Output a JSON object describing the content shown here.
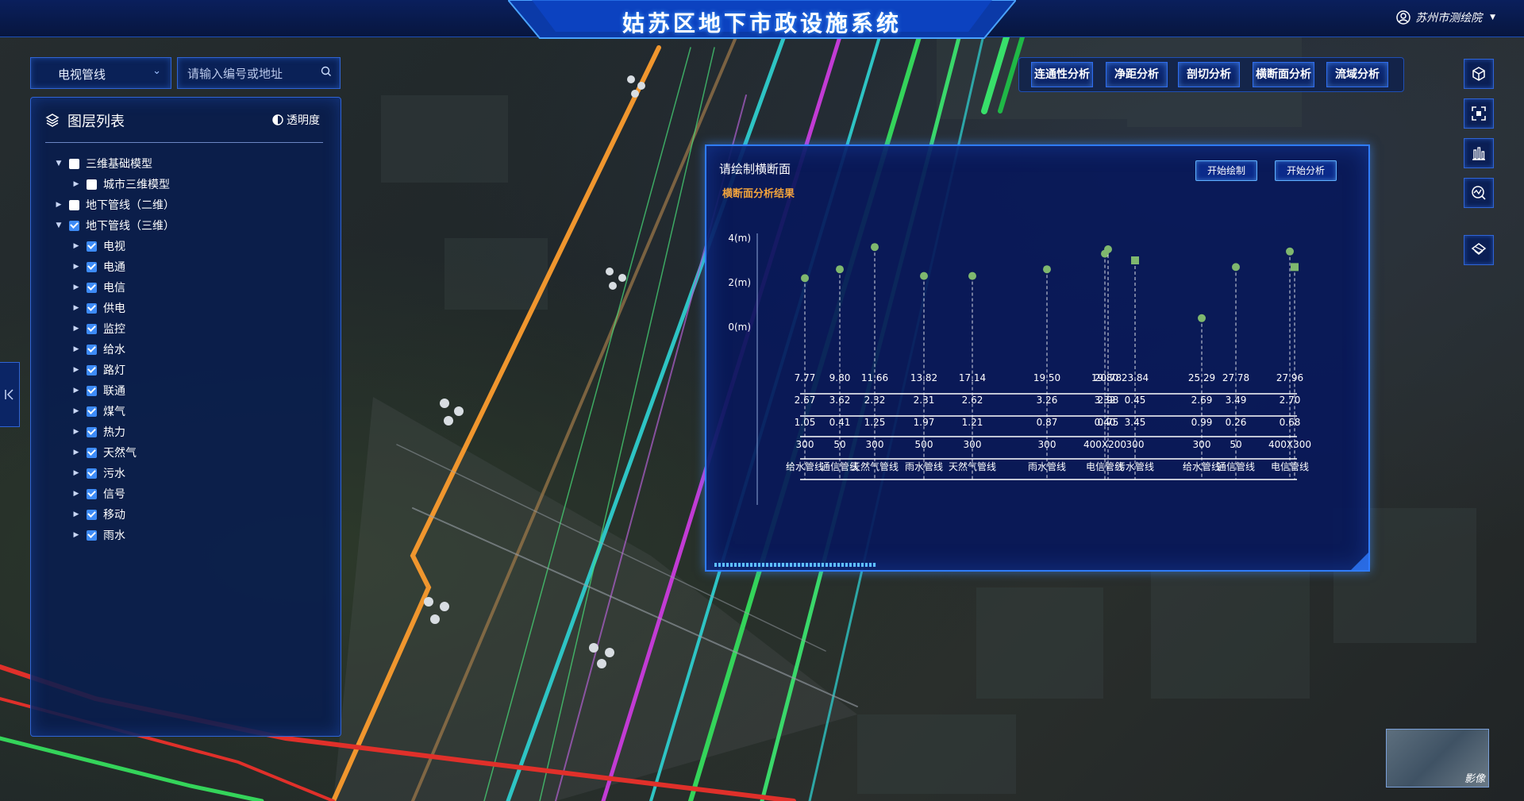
{
  "app": {
    "title": "姑苏区地下市政设施系统",
    "user": "苏州市测绘院"
  },
  "search": {
    "layer_select": "电视管线",
    "placeholder": "请输入编号或地址"
  },
  "toolbar": {
    "buttons": [
      "连通性分析",
      "净距分析",
      "剖切分析",
      "横断面分析",
      "流域分析"
    ]
  },
  "right_tools": [
    "cube-icon",
    "frame-icon",
    "bar-chart-icon",
    "chart-search-icon",
    "layers-icon"
  ],
  "layer_panel": {
    "title": "图层列表",
    "opacity_label": "透明度",
    "tree": [
      {
        "label": "三维基础模型",
        "level": 0,
        "expanded": true,
        "checked": false
      },
      {
        "label": "城市三维模型",
        "level": 1,
        "expanded": false,
        "checked": false
      },
      {
        "label": "地下管线（二维）",
        "level": 0,
        "expanded": false,
        "checked": false
      },
      {
        "label": "地下管线（三维）",
        "level": 0,
        "expanded": true,
        "checked": true
      },
      {
        "label": "电视",
        "level": 1,
        "expanded": false,
        "checked": true
      },
      {
        "label": "电通",
        "level": 1,
        "expanded": false,
        "checked": true
      },
      {
        "label": "电信",
        "level": 1,
        "expanded": false,
        "checked": true
      },
      {
        "label": "供电",
        "level": 1,
        "expanded": false,
        "checked": true
      },
      {
        "label": "监控",
        "level": 1,
        "expanded": false,
        "checked": true
      },
      {
        "label": "给水",
        "level": 1,
        "expanded": false,
        "checked": true
      },
      {
        "label": "路灯",
        "level": 1,
        "expanded": false,
        "checked": true
      },
      {
        "label": "联通",
        "level": 1,
        "expanded": false,
        "checked": true
      },
      {
        "label": "煤气",
        "level": 1,
        "expanded": false,
        "checked": true
      },
      {
        "label": "热力",
        "level": 1,
        "expanded": false,
        "checked": true
      },
      {
        "label": "天然气",
        "level": 1,
        "expanded": false,
        "checked": true
      },
      {
        "label": "污水",
        "level": 1,
        "expanded": false,
        "checked": true
      },
      {
        "label": "信号",
        "level": 1,
        "expanded": false,
        "checked": true
      },
      {
        "label": "移动",
        "level": 1,
        "expanded": false,
        "checked": true
      },
      {
        "label": "雨水",
        "level": 1,
        "expanded": false,
        "checked": true
      }
    ]
  },
  "dialog": {
    "title": "请绘制横断面",
    "subtitle": "横断面分析结果",
    "btn_draw": "开始绘制",
    "btn_analyze": "开始分析",
    "progress": 0.25
  },
  "chart_data": {
    "type": "scatter",
    "y_ticks": [
      "4(m)",
      "2(m)",
      "0(m)"
    ],
    "ylim": [
      -8,
      4.6
    ],
    "points": [
      {
        "dist": "7.77",
        "top": "2.67",
        "depth": "1.05",
        "size": "300",
        "name": "给水管线",
        "y": 2.2,
        "shape": "circle"
      },
      {
        "dist": "9.80",
        "top": "3.62",
        "depth": "0.41",
        "size": "50",
        "name": "通信管线",
        "y": 2.6,
        "shape": "circle"
      },
      {
        "dist": "11.66",
        "top": "2.32",
        "depth": "1.25",
        "size": "300",
        "name": "天然气管线",
        "y": 3.6,
        "shape": "circle"
      },
      {
        "dist": "13.82",
        "top": "2.31",
        "depth": "1.97",
        "size": "500",
        "name": "雨水管线",
        "y": 2.3,
        "shape": "circle"
      },
      {
        "dist": "17.14",
        "top": "2.62",
        "depth": "1.21",
        "size": "300",
        "name": "天然气管线",
        "y": 2.3,
        "shape": "circle"
      },
      {
        "dist": "19.50",
        "top": "3.26",
        "depth": "0.87",
        "size": "300",
        "name": "雨水管线",
        "y": 2.6,
        "shape": "circle"
      },
      {
        "dist": "19.80",
        "top": "3.32",
        "depth": "0.40",
        "size": "400X200",
        "name": "电信管线",
        "y": 3.3,
        "shape": "circle"
      },
      {
        "dist": "20.78",
        "top": "2.98",
        "depth": "0.75",
        "size": "",
        "name": "",
        "y": 3.5,
        "shape": "circle"
      },
      {
        "dist": "23.84",
        "top": "0.45",
        "depth": "3.45",
        "size": "300",
        "name": "污水管线",
        "y": 3.0,
        "shape": "square"
      },
      {
        "dist": "25.29",
        "top": "2.69",
        "depth": "0.99",
        "size": "300",
        "name": "给水管线",
        "y": 0.4,
        "shape": "circle"
      },
      {
        "dist": "27.78",
        "top": "3.49",
        "depth": "0.26",
        "size": "50",
        "name": "通信管线",
        "y": 2.7,
        "shape": "circle"
      },
      {
        "dist": "27.96",
        "top": "2.70",
        "depth": "0.68",
        "size": "400X300",
        "name": "电信管线",
        "y": 3.4,
        "shape": "circle"
      },
      {
        "dist": "",
        "top": "",
        "depth": "",
        "size": "",
        "name": "",
        "y": 2.7,
        "shape": "square"
      }
    ]
  }
}
